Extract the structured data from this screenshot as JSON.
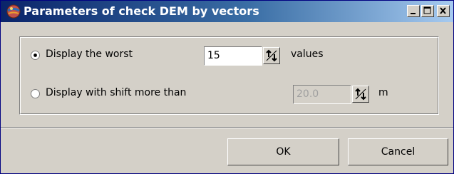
{
  "window": {
    "title": "Parameters of check DEM by vectors",
    "app_icon": "globe-icon",
    "controls": [
      "minimize-icon",
      "maximize-icon",
      "close-icon"
    ]
  },
  "options": {
    "worst": {
      "label": "Display the worst",
      "selected": true,
      "value": "15",
      "unit": "values",
      "enabled": true
    },
    "shift": {
      "label": "Display with shift more than",
      "selected": false,
      "value": "20.0",
      "unit": "m",
      "enabled": false
    }
  },
  "buttons": {
    "ok": "OK",
    "cancel": "Cancel"
  }
}
